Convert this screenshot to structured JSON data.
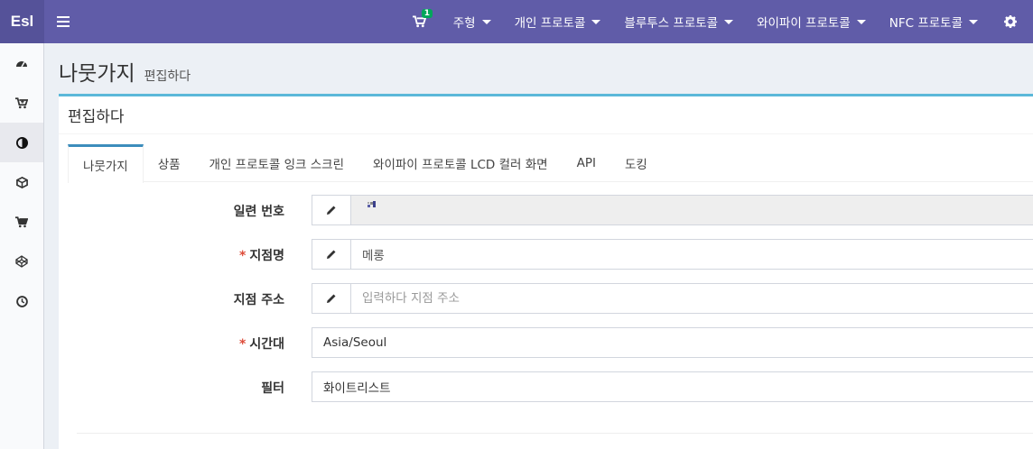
{
  "app": {
    "logo": "Esl"
  },
  "topnav": {
    "cart_count": "1",
    "menus": [
      {
        "label": "주형"
      },
      {
        "label": "개인 프로토콜"
      },
      {
        "label": "블루투스 프로토콜"
      },
      {
        "label": "와이파이 프로토콜"
      },
      {
        "label": "NFC 프로토콜"
      }
    ]
  },
  "sidebar": {
    "items": [
      {
        "icon": "dashboard-icon"
      },
      {
        "icon": "cart-plus-icon"
      },
      {
        "icon": "adjust-icon",
        "active": true
      },
      {
        "icon": "cube-icon"
      },
      {
        "icon": "shopping-cart-icon"
      },
      {
        "icon": "codepen-icon"
      },
      {
        "icon": "clock-icon"
      }
    ]
  },
  "page": {
    "title": "나뭇가지",
    "subtitle": "편집하다"
  },
  "box": {
    "title": "편집하다"
  },
  "tabs": [
    {
      "label": "나뭇가지",
      "active": true
    },
    {
      "label": "상품"
    },
    {
      "label": "개인 프로토콜 잉크 스크린"
    },
    {
      "label": "와이파이 프로토콜 LCD 컬러 화면"
    },
    {
      "label": "API"
    },
    {
      "label": "도킹"
    }
  ],
  "form": {
    "serial": {
      "label": "일련 번호",
      "value": ""
    },
    "store_name": {
      "label": "지점명",
      "required": "*",
      "value": "메롱"
    },
    "store_address": {
      "label": "지점 주소",
      "placeholder": "입력하다 지점 주소",
      "value": ""
    },
    "timezone": {
      "label": "시간대",
      "required": "*",
      "value": "Asia/Seoul"
    },
    "filter": {
      "label": "필터",
      "value": "화이트리스트"
    }
  },
  "colors": {
    "navbar": "#605ca8",
    "accent": "#3c8dbc",
    "box_border": "#5bb8d9",
    "required": "#dd4b39",
    "badge": "#00a65a"
  }
}
